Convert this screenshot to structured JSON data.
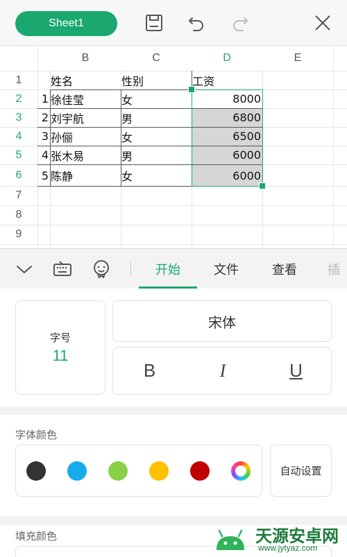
{
  "toolbar": {
    "sheet_label": "Sheet1",
    "icons": [
      "save-icon",
      "undo-icon",
      "redo-icon",
      "close-icon"
    ]
  },
  "grid": {
    "columns": [
      "B",
      "C",
      "D",
      "E"
    ],
    "active_column": "D",
    "rows": [
      "1",
      "2",
      "3",
      "4",
      "5",
      "6",
      "7",
      "8",
      "9"
    ],
    "active_rows": [
      "2",
      "3",
      "4",
      "5",
      "6"
    ],
    "header": {
      "name": "姓名",
      "gender": "性别",
      "salary": "工资"
    },
    "records": [
      {
        "no": "1",
        "name": "徐佳莹",
        "gender": "女",
        "salary": "8000"
      },
      {
        "no": "2",
        "name": "刘宇航",
        "gender": "男",
        "salary": "6800"
      },
      {
        "no": "3",
        "name": "孙俪",
        "gender": "女",
        "salary": "6500"
      },
      {
        "no": "4",
        "name": "张木易",
        "gender": "男",
        "salary": "6000"
      },
      {
        "no": "5",
        "name": "陈静",
        "gender": "女",
        "salary": "6000"
      }
    ],
    "selection_color": "#1aa870"
  },
  "panel": {
    "tabs": [
      "开始",
      "文件",
      "查看",
      "插"
    ],
    "active_tab": "开始",
    "icons": [
      "chevron-down-icon",
      "keyboard-icon",
      "voice-assistant-icon"
    ],
    "font_size_label": "字号",
    "font_size_value": "11",
    "font_name": "宋体",
    "style_buttons": {
      "bold": "B",
      "italic": "I",
      "underline": "U"
    },
    "font_color_title": "字体颜色",
    "font_colors": [
      "#333333",
      "#16aaee",
      "#88d048",
      "#ffc000",
      "#c00000"
    ],
    "auto_label": "自动设置",
    "fill_color_title": "填充颜色"
  },
  "watermark": {
    "brand": "天源安卓网",
    "url": "www.jytyaz.com"
  },
  "accent_color": "#1aa870"
}
